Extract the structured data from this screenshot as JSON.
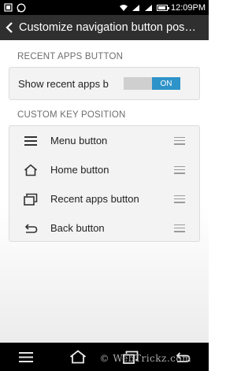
{
  "status_bar": {
    "time": "12:09PM",
    "left_icons": [
      "screenshot-icon",
      "whatsapp-icon"
    ],
    "right_icons": [
      "wifi-icon",
      "signal-icon",
      "signal-icon",
      "battery-icon"
    ]
  },
  "action_bar": {
    "title": "Customize navigation button pos…"
  },
  "recent_apps_section": {
    "header": "RECENT APPS BUTTON",
    "toggle_label": "Show recent apps b",
    "toggle_state": "ON"
  },
  "custom_key_section": {
    "header": "CUSTOM KEY POSITION",
    "items": [
      {
        "label": "Menu button",
        "icon": "menu-icon"
      },
      {
        "label": "Home button",
        "icon": "home-icon"
      },
      {
        "label": "Recent apps button",
        "icon": "recent-apps-icon"
      },
      {
        "label": "Back button",
        "icon": "back-icon"
      }
    ]
  },
  "nav_bar": {
    "buttons": [
      "menu-icon",
      "home-icon",
      "recent-apps-icon",
      "back-icon"
    ]
  },
  "watermark": "© WebTrickz.com",
  "colors": {
    "accent": "#2e93c9",
    "action_bar": "#2f2f2f",
    "status_bar": "#000000"
  }
}
